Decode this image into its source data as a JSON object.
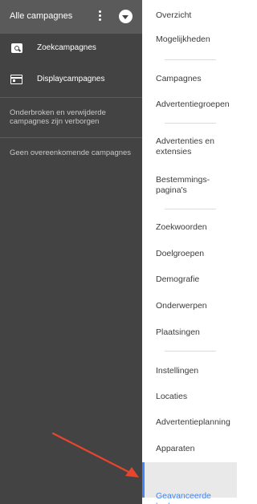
{
  "sidebar": {
    "header_title": "Alle campagnes",
    "campaign_types": [
      {
        "label": "Zoekcampagnes",
        "icon": "search-icon"
      },
      {
        "label": "Displaycampagnes",
        "icon": "display-icon"
      }
    ],
    "hidden_note": "Onderbroken en verwijderde campagnes zijn verborgen",
    "empty_note": "Geen overeenkomende campagnes"
  },
  "menu": {
    "items": [
      {
        "label": "Overzicht"
      },
      {
        "label": "Mogelijkheden"
      },
      {
        "label": "Campagnes"
      },
      {
        "label": "Advertentiegroepen"
      },
      {
        "label": "Advertenties en extensies"
      },
      {
        "label": "Bestemmings-pagina's"
      },
      {
        "label": "Zoekwoorden"
      },
      {
        "label": "Doelgroepen"
      },
      {
        "label": "Demografie"
      },
      {
        "label": "Onderwerpen"
      },
      {
        "label": "Plaatsingen"
      },
      {
        "label": "Instellingen"
      },
      {
        "label": "Locaties"
      },
      {
        "label": "Advertentieplanning"
      },
      {
        "label": "Apparaten"
      },
      {
        "label": "Geavanceerde bodaanp."
      }
    ],
    "active_index": 15
  },
  "colors": {
    "sidebar_bg": "#434343",
    "sidebar_header_bg": "#5a5a5a",
    "accent": "#4285f4",
    "arrow": "#e8452c"
  }
}
